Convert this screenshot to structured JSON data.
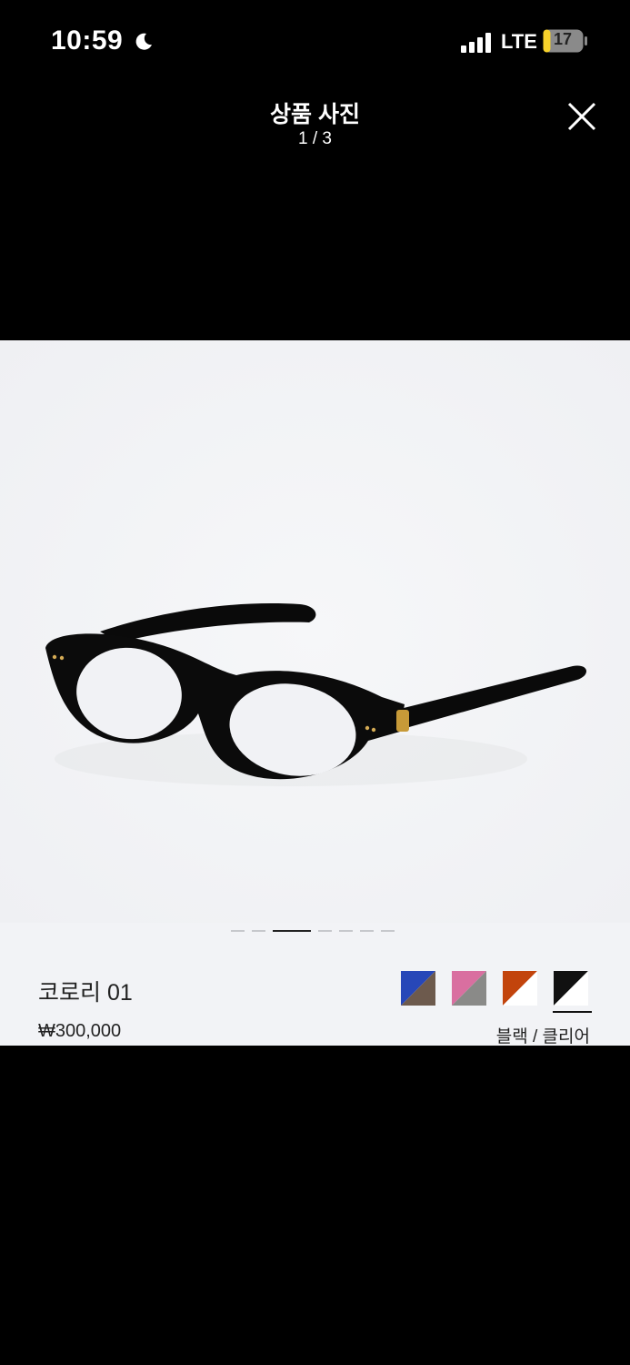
{
  "status_bar": {
    "time": "10:59",
    "network": "LTE",
    "battery": "17"
  },
  "header": {
    "title": "상품 사진",
    "counter": "1 / 3"
  },
  "gallery": {
    "pages": 7,
    "active_page": 3
  },
  "product": {
    "name": "코로리 01",
    "price": "₩300,000",
    "selected_color": "블랙 / 클리어",
    "swatches": [
      {
        "name": "blue",
        "top": "#2747b8",
        "bottom": "#6d5a4d"
      },
      {
        "name": "pink",
        "top": "#d96fa0",
        "bottom": "#8a8a88"
      },
      {
        "name": "orange",
        "top": "#c2440c",
        "bottom": "#ffffff"
      },
      {
        "name": "black",
        "top": "#111111",
        "bottom": "#ffffff"
      }
    ]
  }
}
